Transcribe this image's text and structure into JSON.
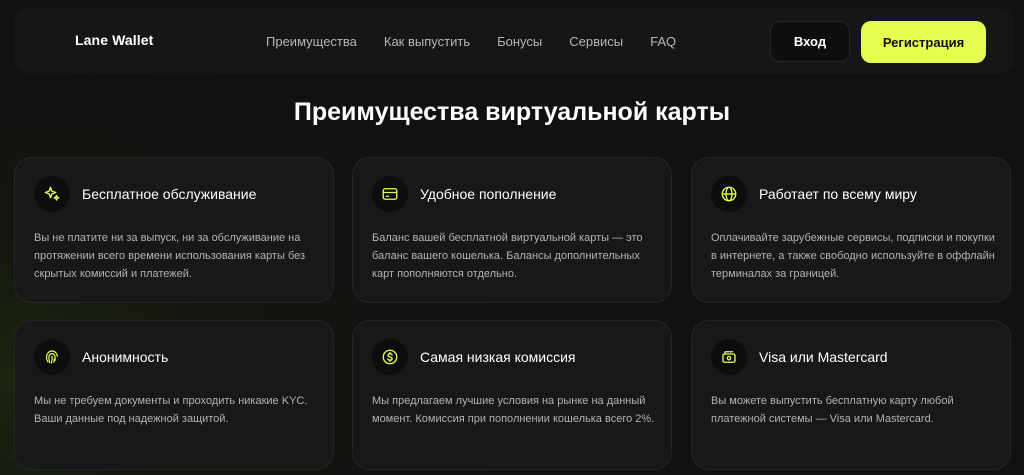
{
  "colors": {
    "accent": "#e6fd50"
  },
  "header": {
    "logo": "Lane Wallet",
    "nav": [
      "Преимущества",
      "Как выпустить",
      "Бонусы",
      "Сервисы",
      "FAQ"
    ],
    "login_label": "Вход",
    "register_label": "Регистрация"
  },
  "section": {
    "title": "Преимущества виртуальной карты",
    "cards": [
      {
        "icon": "sparkle-icon",
        "title": "Бесплатное обслуживание",
        "text": "Вы не платите ни за выпуск, ни за обслуживание на протяжении всего времени использования карты без скрытых комиссий и платежей."
      },
      {
        "icon": "credit-card-icon",
        "title": "Удобное пополнение",
        "text": "Баланс вашей бесплатной виртуальной карты — это баланс вашего кошелька. Балансы дополнительных карт пополняются отдельно."
      },
      {
        "icon": "globe-icon",
        "title": "Работает по всему миру",
        "text": "Оплачивайте зарубежные сервисы, подписки и покупки в интернете, а также свободно используйте в оффлайн терминалах за границей."
      },
      {
        "icon": "fingerprint-icon",
        "title": "Анонимность",
        "text": "Мы не требуем документы и проходить никакие KYC. Ваши данные под надежной защитой."
      },
      {
        "icon": "dollar-coin-icon",
        "title": "Самая низкая комиссия",
        "text": "Мы предлагаем лучшие условия на рынке на данный момент. Комиссия при пополнении кошелька всего 2%."
      },
      {
        "icon": "wallet-cards-icon",
        "title": "Visa или Mastercard",
        "text": "Вы можете выпустить бесплатную карту любой платежной системы — Visa или Mastercard."
      }
    ]
  }
}
